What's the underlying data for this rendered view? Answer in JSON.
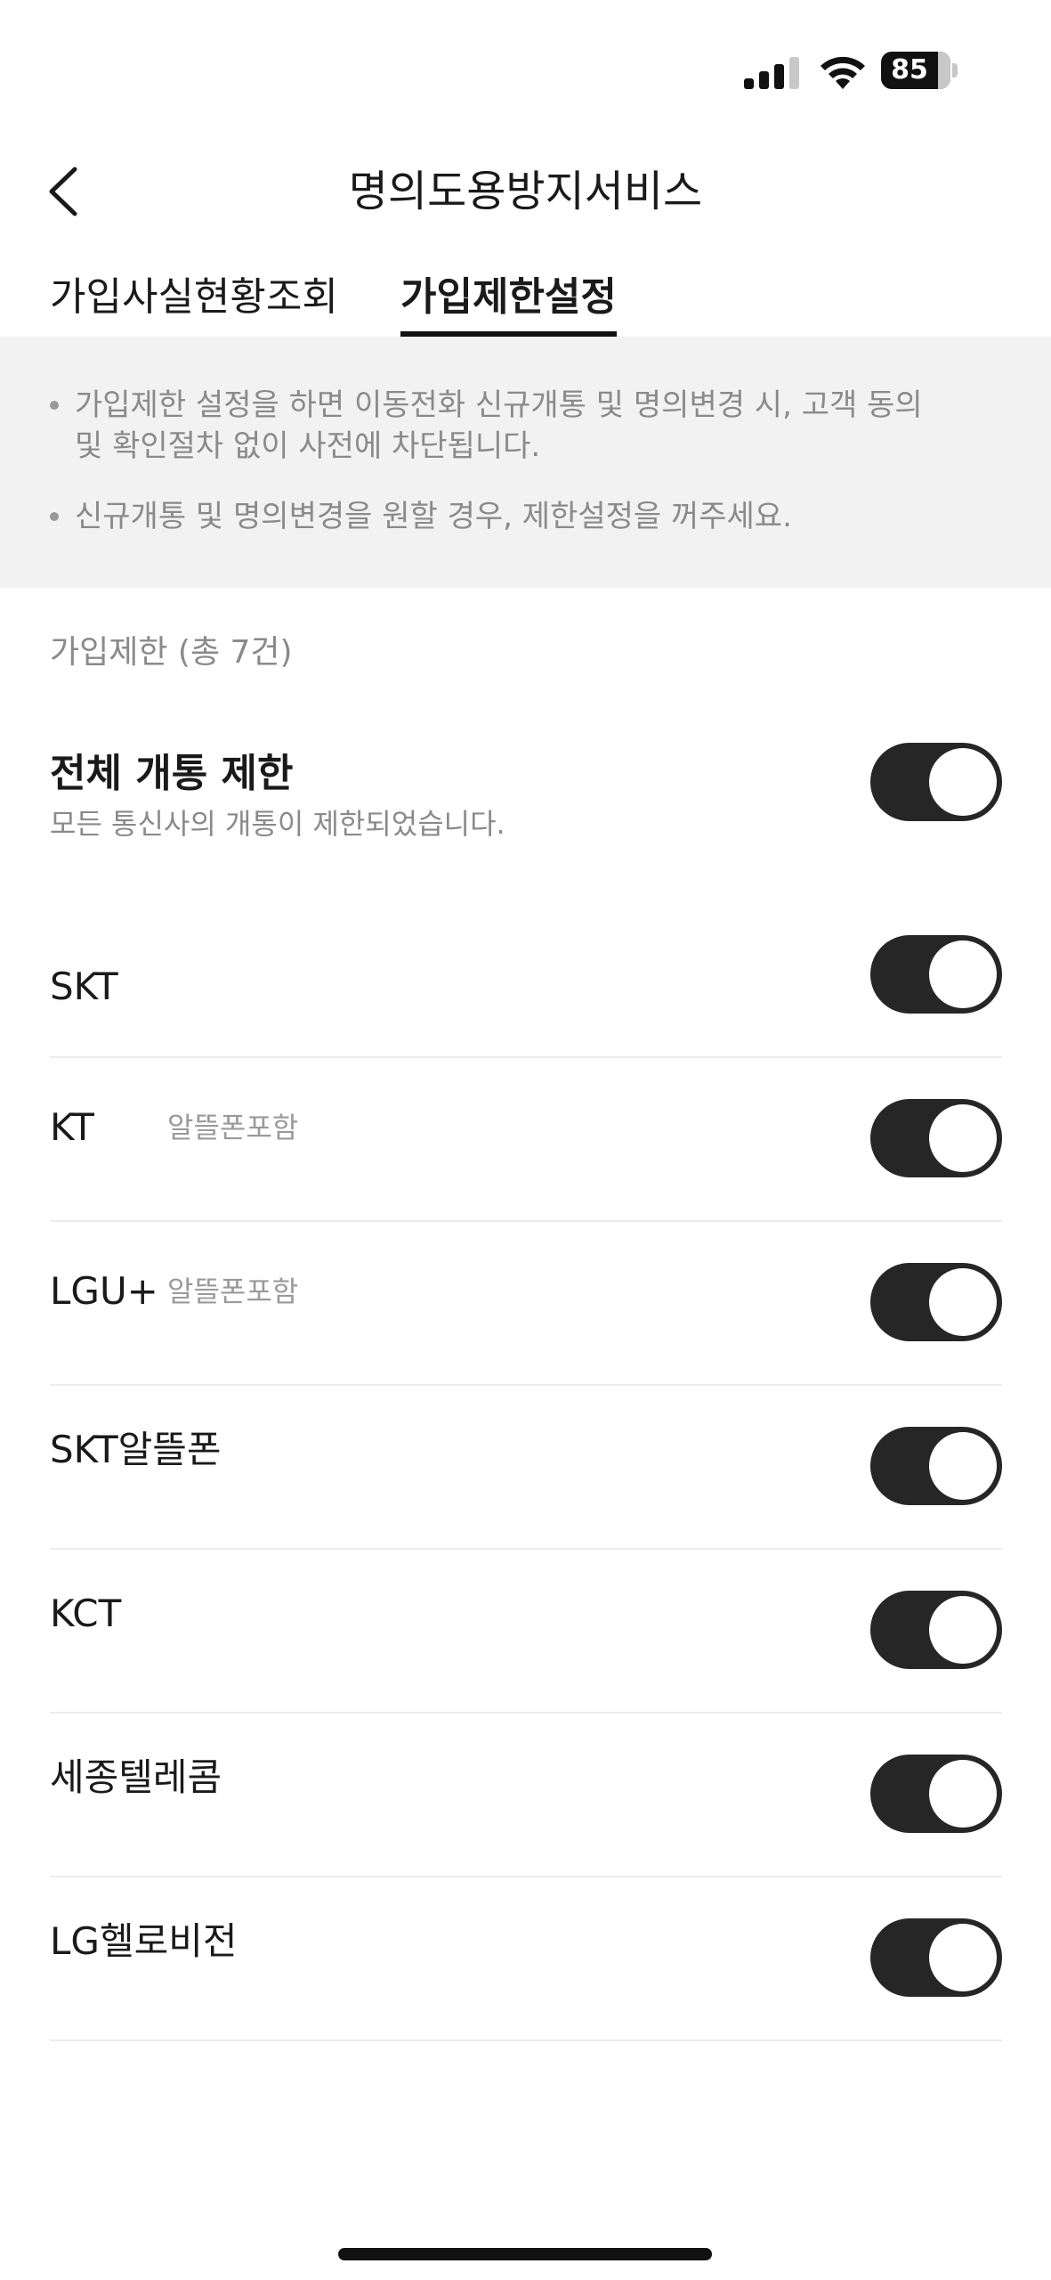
{
  "status_bar": {
    "battery_level": "85"
  },
  "header": {
    "title": "명의도용방지서비스"
  },
  "tabs": [
    {
      "label": "가입사실현황조회",
      "active": false
    },
    {
      "label": "가입제한설정",
      "active": true
    }
  ],
  "notice": {
    "items": [
      "가입제한 설정을 하면 이동전화 신규개통 및 명의변경 시, 고객 동의 및 확인절차 없이 사전에 차단됩니다.",
      "신규개통 및 명의변경을 원할 경우, 제한설정을 꺼주세요."
    ]
  },
  "section": {
    "title": "가입제한 (총 7건)"
  },
  "master": {
    "label": "전체 개통 제한",
    "description": "모든 통신사의 개통이 제한되었습니다.",
    "enabled": true
  },
  "carriers": [
    {
      "label": "SKT",
      "sub": "",
      "enabled": true
    },
    {
      "label": "KT",
      "sub": "알뜰폰포함",
      "enabled": true
    },
    {
      "label": "LGU+",
      "sub": "알뜰폰포함",
      "enabled": true
    },
    {
      "label": "SKT알뜰폰",
      "sub": "",
      "enabled": true
    },
    {
      "label": "KCT",
      "sub": "",
      "enabled": true
    },
    {
      "label": "세종텔레콤",
      "sub": "",
      "enabled": true
    },
    {
      "label": "LG헬로비전",
      "sub": "",
      "enabled": true
    }
  ],
  "colors": {
    "toggle_on": "#262626",
    "notice_bg": "#f2f2f2",
    "muted_text": "#8a8a8a"
  }
}
